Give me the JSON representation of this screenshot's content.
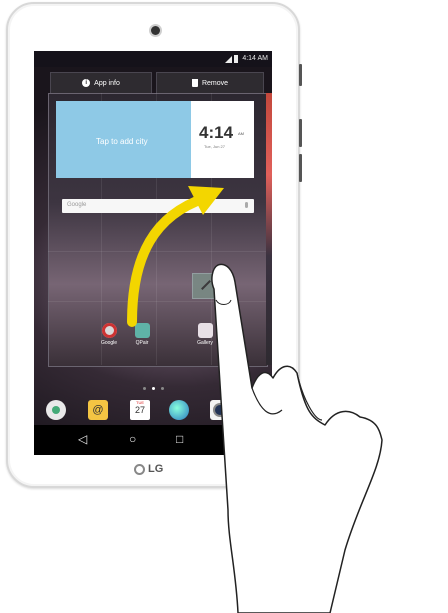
{
  "status_bar": {
    "time": "4:14 AM"
  },
  "recent_apps": {
    "app_info_label": "App info",
    "remove_label": "Remove"
  },
  "weather_widget": {
    "prompt": "Tap to add city",
    "clock_time": "4:14",
    "clock_ampm": "AM",
    "date": "Tue, Jun 27"
  },
  "search_bar": {
    "placeholder": "Google"
  },
  "apps": [
    {
      "label": "Google"
    },
    {
      "label": "QPair"
    },
    {
      "label": "Gallery"
    }
  ],
  "dock_calendar": {
    "day": "TUE",
    "date": "27"
  },
  "brand": {
    "logo_text": "LG"
  },
  "colors": {
    "accent_arrow": "#f3d600",
    "weather_bg": "#8ec9e6",
    "remove_bar": "#2e2b30"
  }
}
